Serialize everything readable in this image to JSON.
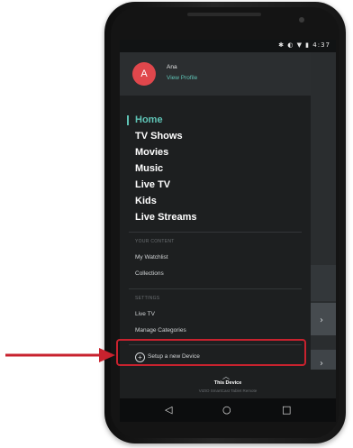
{
  "status_bar": {
    "icons": "✱ ◐ ▼ ▮",
    "time": "4:37"
  },
  "profile": {
    "initial": "A",
    "name": "Ana",
    "link": "View Profile"
  },
  "nav": {
    "items": [
      {
        "label": "Home",
        "active": true
      },
      {
        "label": "TV Shows"
      },
      {
        "label": "Movies"
      },
      {
        "label": "Music"
      },
      {
        "label": "Live TV"
      },
      {
        "label": "Kids"
      },
      {
        "label": "Live Streams"
      }
    ]
  },
  "your_content": {
    "heading": "YOUR CONTENT",
    "items": [
      {
        "label": "My Watchlist"
      },
      {
        "label": "Collections"
      }
    ]
  },
  "settings": {
    "heading": "SETTINGS",
    "items": [
      {
        "label": "Live TV"
      },
      {
        "label": "Manage Categories"
      }
    ]
  },
  "setup": {
    "icon": "+",
    "label": "Setup a new Device"
  },
  "device_bar": {
    "caret": "︿",
    "title": "This Device",
    "subtitle": "VIZIO SmartCast Tablet Remote"
  },
  "android_nav": {
    "back": "◁",
    "home": "○",
    "recents": "□"
  },
  "background": {
    "chevron": "›"
  },
  "colors": {
    "accent": "#5fc4b6",
    "avatar": "#e0474c",
    "annotation": "#c8222e"
  }
}
